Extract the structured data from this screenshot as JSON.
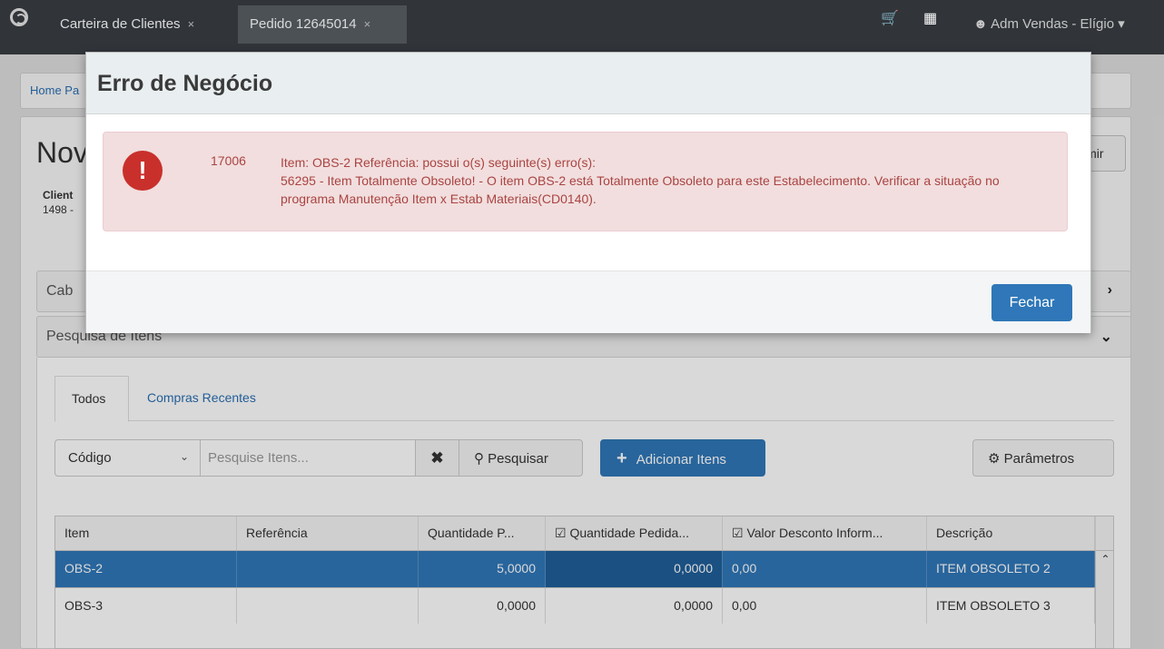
{
  "topbar": {
    "tabs": [
      {
        "label": "Carteira de Clientes",
        "close": "×"
      },
      {
        "label": "Pedido 12645014",
        "close": "×"
      }
    ],
    "user": "Adm Vendas - Elígio"
  },
  "page": {
    "breadcrumb": "Home Pa",
    "title": "Nov",
    "client_label": "Client",
    "client_value": "1498 -",
    "print_label": "imir",
    "sections": [
      {
        "label": "Cab",
        "chevron": "›"
      },
      {
        "label": "Pesquisa de Itens",
        "chevron": "⌄"
      }
    ],
    "tabs": [
      "Todos",
      "Compras Recentes"
    ],
    "search": {
      "filter_value": "Código",
      "placeholder": "Pesquise Itens...",
      "search_label": "Pesquisar",
      "add_label": "Adicionar Itens",
      "params_label": "Parâmetros"
    },
    "grid": {
      "headers": [
        "Item",
        "Referência",
        "Quantidade P...",
        "Quantidade Pedida...",
        "Valor Desconto Inform...",
        "Descrição"
      ],
      "rows": [
        [
          "OBS-2",
          "",
          "5,0000",
          "0,0000",
          "0,00",
          "ITEM OBSOLETO 2"
        ],
        [
          "OBS-3",
          "",
          "0,0000",
          "0,0000",
          "0,00",
          "ITEM OBSOLETO 3"
        ]
      ]
    }
  },
  "modal": {
    "title": "Erro de Negócio",
    "code": "17006",
    "message_line1": "Item: OBS-2 Referência: possui o(s) seguinte(s) erro(s):",
    "message_line2": "56295 - Item Totalmente Obsoleto! - O item OBS-2 está Totalmente Obsoleto para este Estabelecimento. Verificar a situação no programa Manutenção Item x Estab Materiais(CD0140).",
    "close_label": "Fechar"
  }
}
